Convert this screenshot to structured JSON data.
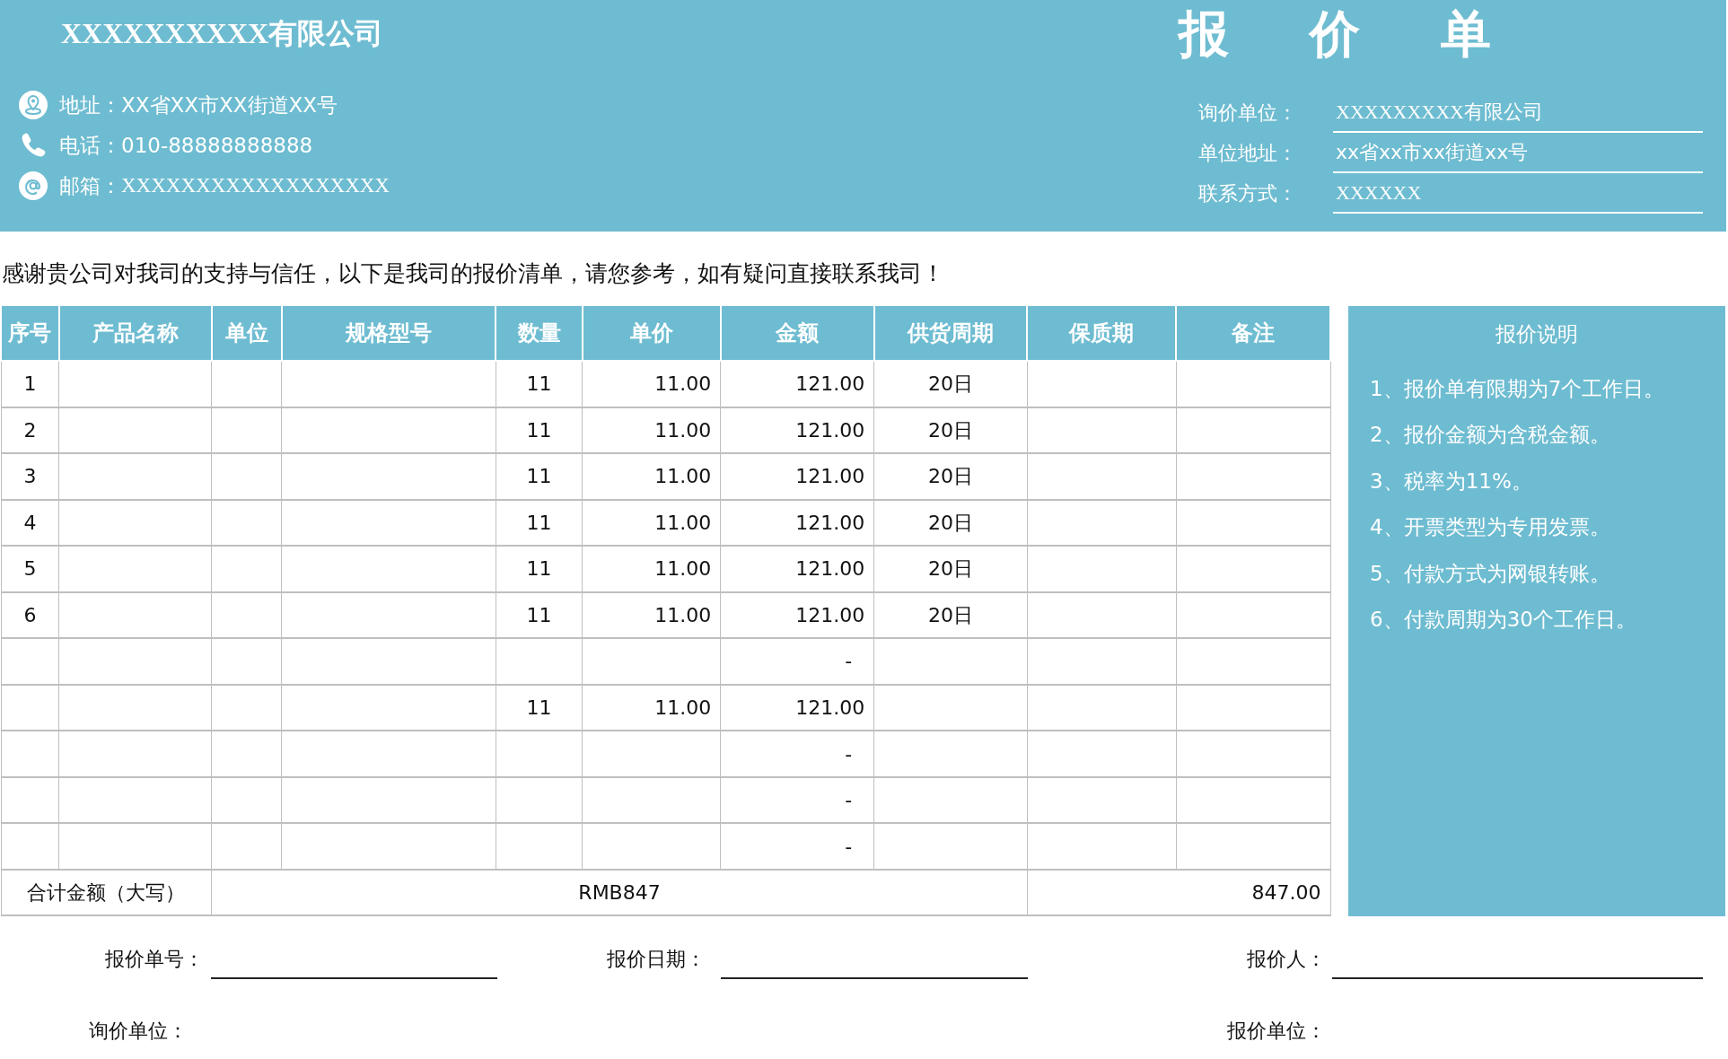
{
  "header": {
    "company": "XXXXXXXXXX有限公司",
    "title": "报价单",
    "contacts": [
      {
        "kind": "address",
        "label": "地址：",
        "value": "XX省XX市XX街道XX号"
      },
      {
        "kind": "phone",
        "label": "电话：",
        "value": "010-88888888888"
      },
      {
        "kind": "email",
        "label": "邮箱：",
        "value": "XXXXXXXXXXXXXXXXXX"
      }
    ],
    "client": [
      {
        "label": "询价单位：",
        "value": "XXXXXXXXX有限公司"
      },
      {
        "label": "单位地址：",
        "value": "xx省xx市xx街道xx号"
      },
      {
        "label": "联系方式：",
        "value": "XXXXXX"
      }
    ]
  },
  "intro": "感谢贵公司对我司的支持与信任，以下是我司的报价清单，请您参考，如有疑问直接联系我司！",
  "table": {
    "columns": [
      "序号",
      "产品名称",
      "单位",
      "规格型号",
      "数量",
      "单价",
      "金额",
      "供货周期",
      "保质期",
      "备注"
    ],
    "rows": [
      {
        "no": "1",
        "qty": "11",
        "price": "11.00",
        "amount": "121.00",
        "cycle": "20日"
      },
      {
        "no": "2",
        "qty": "11",
        "price": "11.00",
        "amount": "121.00",
        "cycle": "20日"
      },
      {
        "no": "3",
        "qty": "11",
        "price": "11.00",
        "amount": "121.00",
        "cycle": "20日"
      },
      {
        "no": "4",
        "qty": "11",
        "price": "11.00",
        "amount": "121.00",
        "cycle": "20日"
      },
      {
        "no": "5",
        "qty": "11",
        "price": "11.00",
        "amount": "121.00",
        "cycle": "20日"
      },
      {
        "no": "6",
        "qty": "11",
        "price": "11.00",
        "amount": "121.00",
        "cycle": "20日"
      },
      {
        "amount": "-"
      },
      {
        "qty": "11",
        "price": "11.00",
        "amount": "121.00"
      },
      {
        "amount": "-"
      },
      {
        "amount": "-"
      },
      {
        "amount": "-"
      }
    ],
    "total": {
      "label": "合计金额（大写）",
      "words": "RMB847",
      "amount": "847.00"
    }
  },
  "notes": {
    "title": "报价说明",
    "items": [
      "1、报价单有限期为7个工作日。",
      "2、报价金额为含税金额。",
      "3、税率为11%。",
      "4、开票类型为专用发票。",
      "5、付款方式为网银转账。",
      "6、付款周期为30个工作日。"
    ]
  },
  "footer": {
    "quote_no": "报价单号：",
    "quote_date": "报价日期：",
    "quoter": "报价人：",
    "inquirer": "询价单位：",
    "quoting_unit": "报价单位："
  }
}
